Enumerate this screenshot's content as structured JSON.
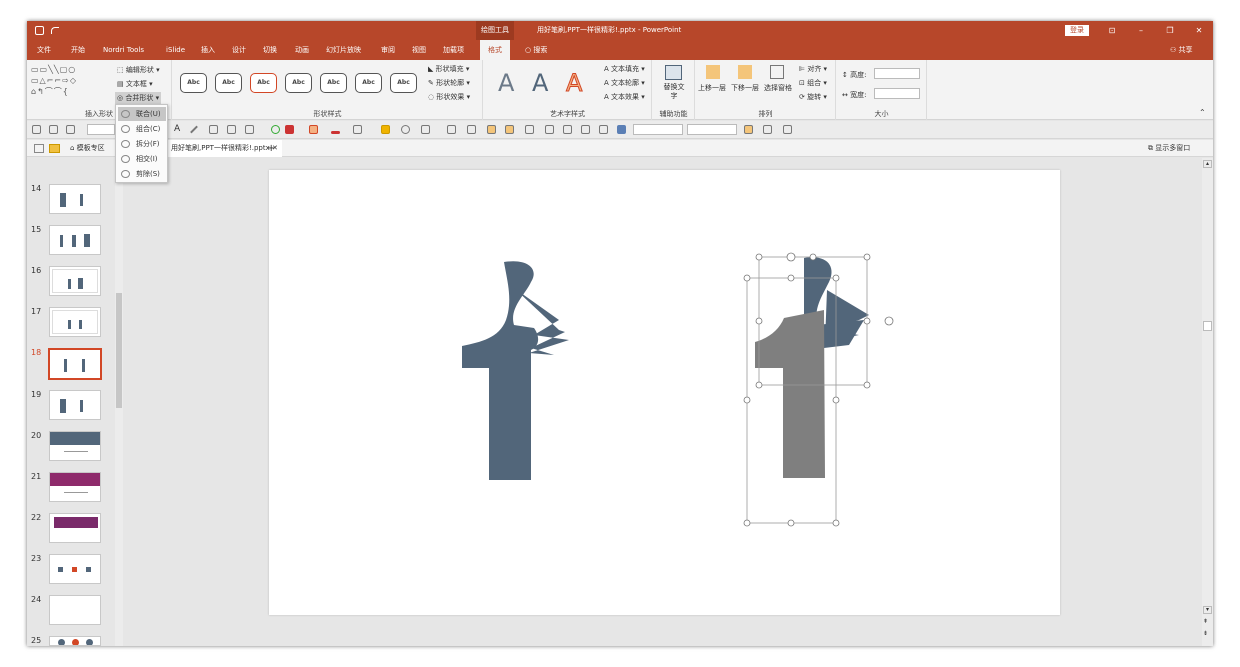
{
  "titlebar": {
    "context_tool": "绘图工具",
    "doc_title": "用好笔刷,PPT一样很精彩!.pptx - PowerPoint",
    "login": "登录",
    "restore_ribbon": "⊡",
    "minimize": "–",
    "maximize": "❐",
    "close": "✕"
  },
  "tabs": [
    "文件",
    "开始",
    "Nordri Tools",
    "iSlide",
    "插入",
    "设计",
    "切换",
    "动画",
    "幻灯片放映",
    "审阅",
    "视图",
    "加载项",
    "格式"
  ],
  "search_label": "搜索",
  "share_label": "共享",
  "ribbon": {
    "insert_shapes": {
      "edit_shape": "编辑形状",
      "textbox": "文本框",
      "merge_shapes": "合并形状",
      "label": "插入形状"
    },
    "shape_styles": {
      "style_sample": "Abc",
      "fill": "形状填充",
      "outline": "形状轮廓",
      "effects": "形状效果",
      "label": "形状样式"
    },
    "wordart": {
      "letter": "A",
      "text_fill": "文本填充",
      "text_outline": "文本轮廓",
      "text_effects": "文本效果",
      "label": "艺术字样式"
    },
    "accessibility": {
      "alt_text": "替换文字",
      "label": "辅助功能"
    },
    "arrange": {
      "bring_forward": "上移一层",
      "send_backward": "下移一层",
      "selection_pane": "选择窗格",
      "align": "对齐",
      "group": "组合",
      "rotate": "旋转",
      "label": "排列"
    },
    "size": {
      "height": "高度:",
      "width": "宽度:",
      "label": "大小"
    }
  },
  "merge_menu": {
    "items": [
      "联合(U)",
      "组合(C)",
      "拆分(F)",
      "相交(I)",
      "剪除(S)"
    ]
  },
  "doc_tabs": {
    "home": "模板专区",
    "file": "用好笔刷,PPT一样很精彩!.pptx",
    "multi_window": "显示多窗口"
  },
  "thumbnails": [
    "14",
    "15",
    "16",
    "17",
    "18",
    "19",
    "20",
    "21",
    "22",
    "23",
    "24",
    "25"
  ],
  "selected_slide": "18",
  "colors": {
    "accent": "#b7472a",
    "brush": "#52667a",
    "gray_shape": "#7f7f7f"
  }
}
